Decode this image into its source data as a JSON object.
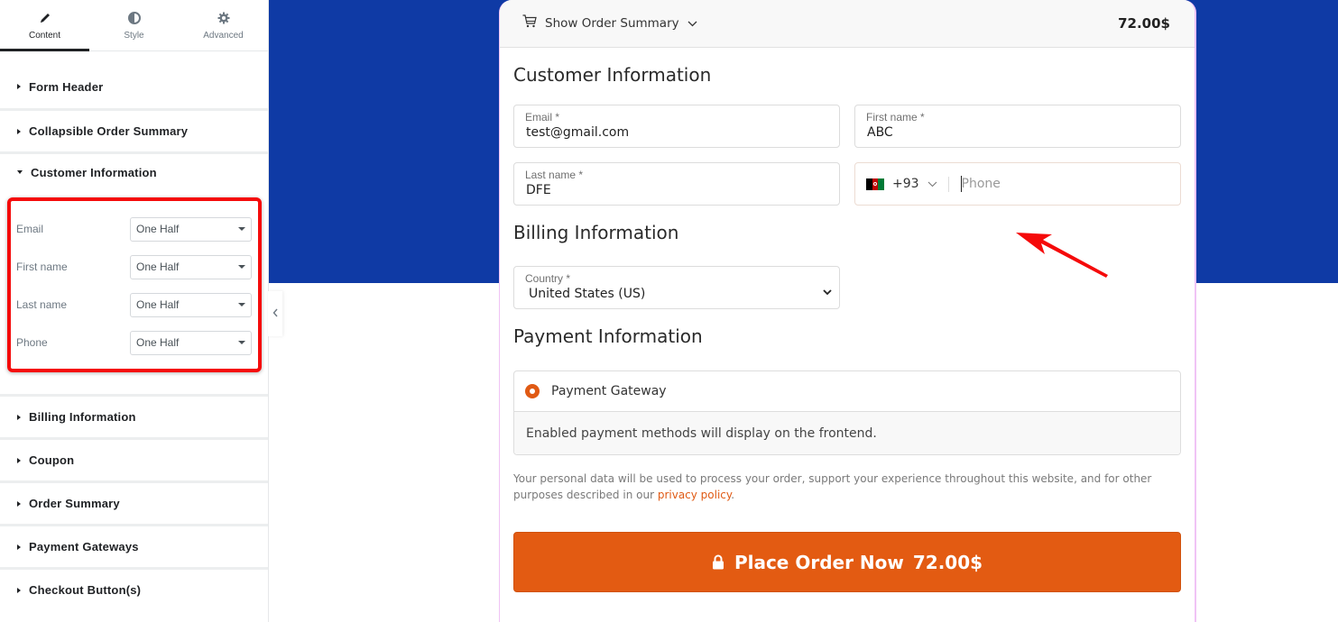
{
  "sidebar": {
    "tabs": [
      {
        "label": "Content",
        "icon": "pencil-icon",
        "active": true
      },
      {
        "label": "Style",
        "icon": "contrast-icon",
        "active": false
      },
      {
        "label": "Advanced",
        "icon": "gear-icon",
        "active": false
      }
    ],
    "sections": [
      {
        "title": "Form Header",
        "expanded": false
      },
      {
        "title": "Collapsible Order Summary",
        "expanded": false
      },
      {
        "title": "Customer Information",
        "expanded": true
      },
      {
        "title": "Billing Information",
        "expanded": false
      },
      {
        "title": "Coupon",
        "expanded": false
      },
      {
        "title": "Order Summary",
        "expanded": false
      },
      {
        "title": "Payment Gateways",
        "expanded": false
      },
      {
        "title": "Checkout Button(s)",
        "expanded": false
      }
    ],
    "customer_controls": [
      {
        "label": "Email",
        "value": "One Half"
      },
      {
        "label": "First name",
        "value": "One Half"
      },
      {
        "label": "Last name",
        "value": "One Half"
      },
      {
        "label": "Phone",
        "value": "One Half"
      }
    ],
    "collapse_icon": "chevron-left-icon"
  },
  "checkout": {
    "summary_bar": {
      "label": "Show Order Summary",
      "total": "72.00$",
      "icon": "cart-icon"
    },
    "customer": {
      "title": "Customer Information",
      "email": {
        "label": "Email *",
        "value": "test@gmail.com"
      },
      "first_name": {
        "label": "First name *",
        "value": "ABC"
      },
      "last_name": {
        "label": "Last name *",
        "value": "DFE"
      },
      "phone": {
        "country_code": "+93",
        "placeholder": "Phone",
        "flag": "afghanistan-flag"
      }
    },
    "billing": {
      "title": "Billing Information",
      "country": {
        "label": "Country *",
        "value": "United States (US)"
      }
    },
    "payment": {
      "title": "Payment Information",
      "gateway": "Payment Gateway",
      "note": "Enabled payment methods will display on the frontend."
    },
    "privacy": {
      "text_before": "Your personal data will be used to process your order, support your experience throughout this website, and for other purposes described in our ",
      "link": "privacy policy",
      "text_after": "."
    },
    "place_order": {
      "label": "Place Order Now",
      "amount": "72.00$"
    }
  },
  "colors": {
    "accent": "#e35b12",
    "canvas_band": "#0f3aa5",
    "highlight": "#f50a0a"
  }
}
